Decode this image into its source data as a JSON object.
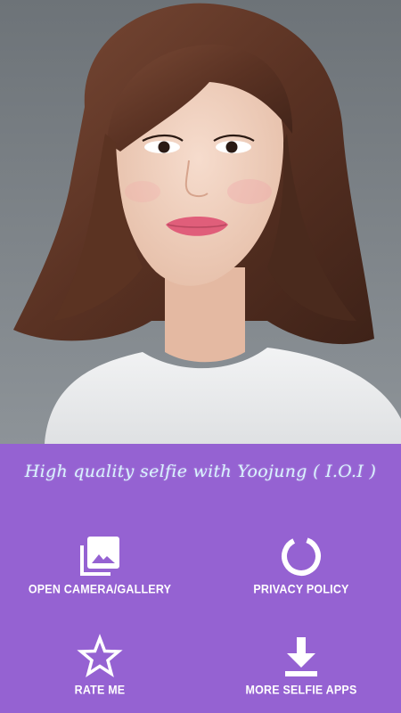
{
  "headline": "High quality selfie with Yoojung ( I.O.I )",
  "menu": {
    "open_camera_gallery": {
      "label": "OPEN CAMERA/GALLERY",
      "icon": "gallery-icon"
    },
    "privacy_policy": {
      "label": "PRIVACY POLICY",
      "icon": "ring-loader-icon"
    },
    "rate_me": {
      "label": "RATE ME",
      "icon": "star-outline-icon"
    },
    "more_selfie_apps": {
      "label": "MORE SELFIE APPS",
      "icon": "download-icon"
    }
  },
  "colors": {
    "panel_background": "#9562d2",
    "headline_text": "#d9f4ff",
    "label_text": "#ffffff",
    "photo_background": "#767c81"
  }
}
